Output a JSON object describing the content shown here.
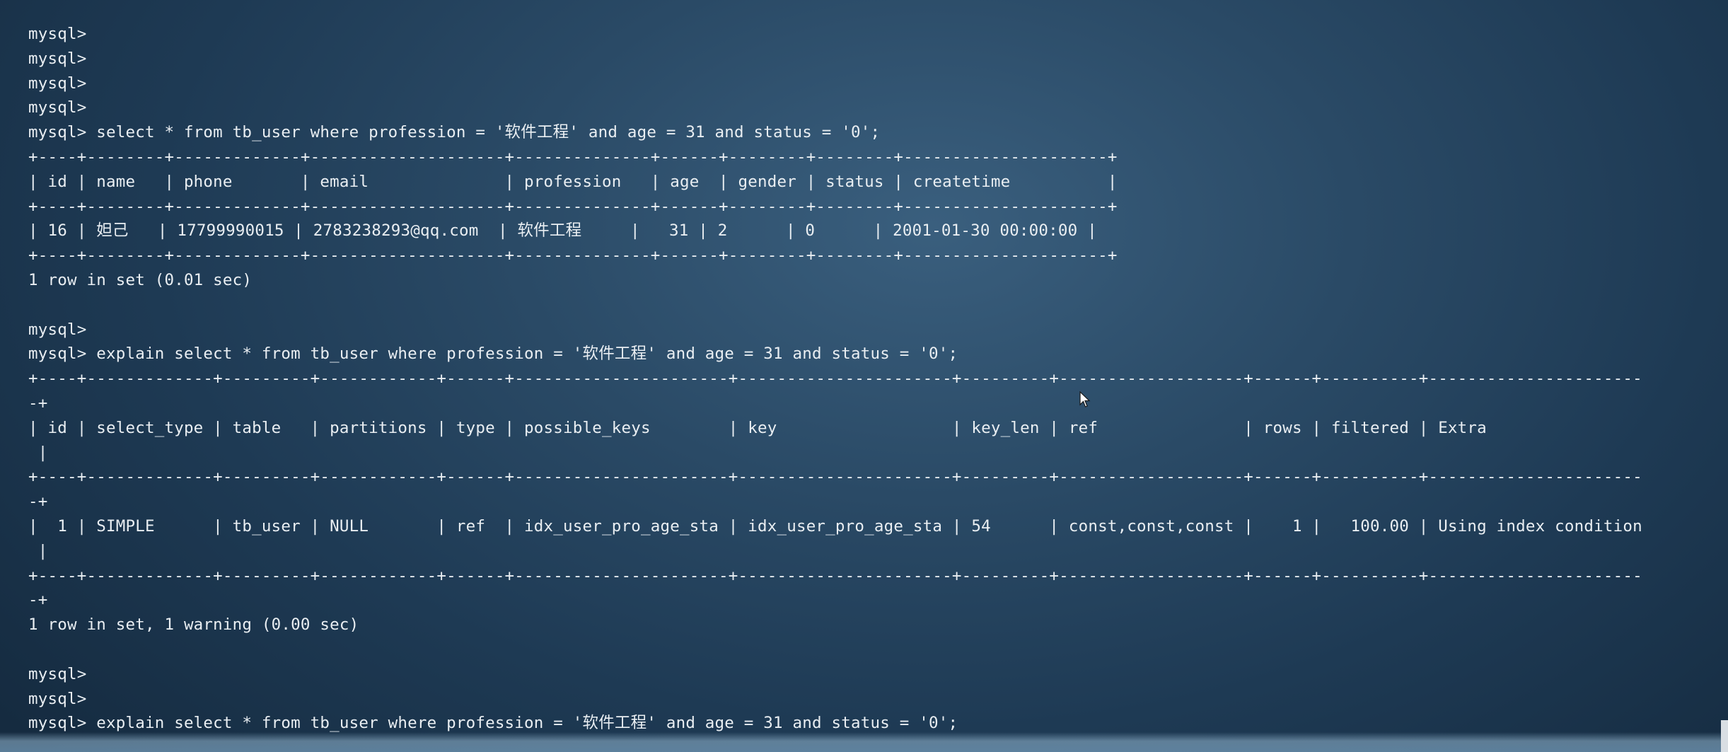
{
  "terminal": {
    "lines": [
      "mysql>",
      "mysql>",
      "mysql>",
      "mysql>",
      "mysql> select * from tb_user where profession = '软件工程' and age = 31 and status = '0';",
      "+----+--------+-------------+--------------------+--------------+------+--------+--------+---------------------+",
      "| id | name   | phone       | email              | profession   | age  | gender | status | createtime          |",
      "+----+--------+-------------+--------------------+--------------+------+--------+--------+---------------------+",
      "| 16 | 妲己   | 17799990015 | 2783238293@qq.com  | 软件工程     |   31 | 2      | 0      | 2001-01-30 00:00:00 |",
      "+----+--------+-------------+--------------------+--------------+------+--------+--------+---------------------+",
      "1 row in set (0.01 sec)",
      "",
      "mysql>",
      "mysql> explain select * from tb_user where profession = '软件工程' and age = 31 and status = '0';",
      "+----+-------------+---------+------------+------+----------------------+----------------------+---------+-------------------+------+----------+----------------------",
      "-+",
      "| id | select_type | table   | partitions | type | possible_keys        | key                  | key_len | ref               | rows | filtered | Extra",
      " |",
      "+----+-------------+---------+------------+------+----------------------+----------------------+---------+-------------------+------+----------+----------------------",
      "-+",
      "|  1 | SIMPLE      | tb_user | NULL       | ref  | idx_user_pro_age_sta | idx_user_pro_age_sta | 54      | const,const,const |    1 |   100.00 | Using index condition",
      " |",
      "+----+-------------+---------+------------+------+----------------------+----------------------+---------+-------------------+------+----------+----------------------",
      "-+",
      "1 row in set, 1 warning (0.00 sec)",
      "",
      "mysql>",
      "mysql>",
      "mysql> explain select * from tb_user where profession = '软件工程' and age = 31 and status = '0';"
    ]
  }
}
